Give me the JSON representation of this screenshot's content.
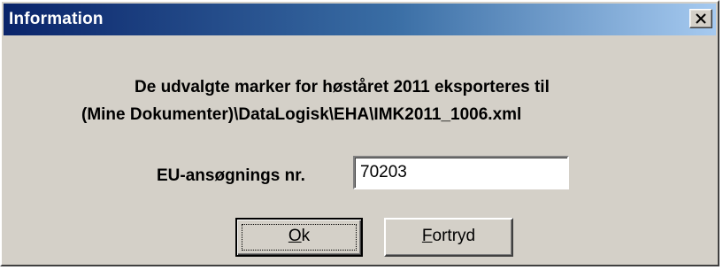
{
  "window": {
    "title": "Information"
  },
  "message": {
    "line1": "De udvalgte marker for høståret 2011 eksporteres til",
    "line2": "(Mine Dokumenter)\\DataLogisk\\EHA\\IMK2011_1006.xml"
  },
  "eu_field": {
    "label": "EU-ansøgnings nr.",
    "value": "70203"
  },
  "buttons": {
    "ok_mnemonic": "O",
    "ok_rest": "k",
    "cancel_mnemonic": "F",
    "cancel_rest": "ortryd"
  },
  "colors": {
    "titlebar_start": "#0a246a",
    "titlebar_end": "#a6caf0",
    "dialog_face": "#d4d0c8"
  }
}
